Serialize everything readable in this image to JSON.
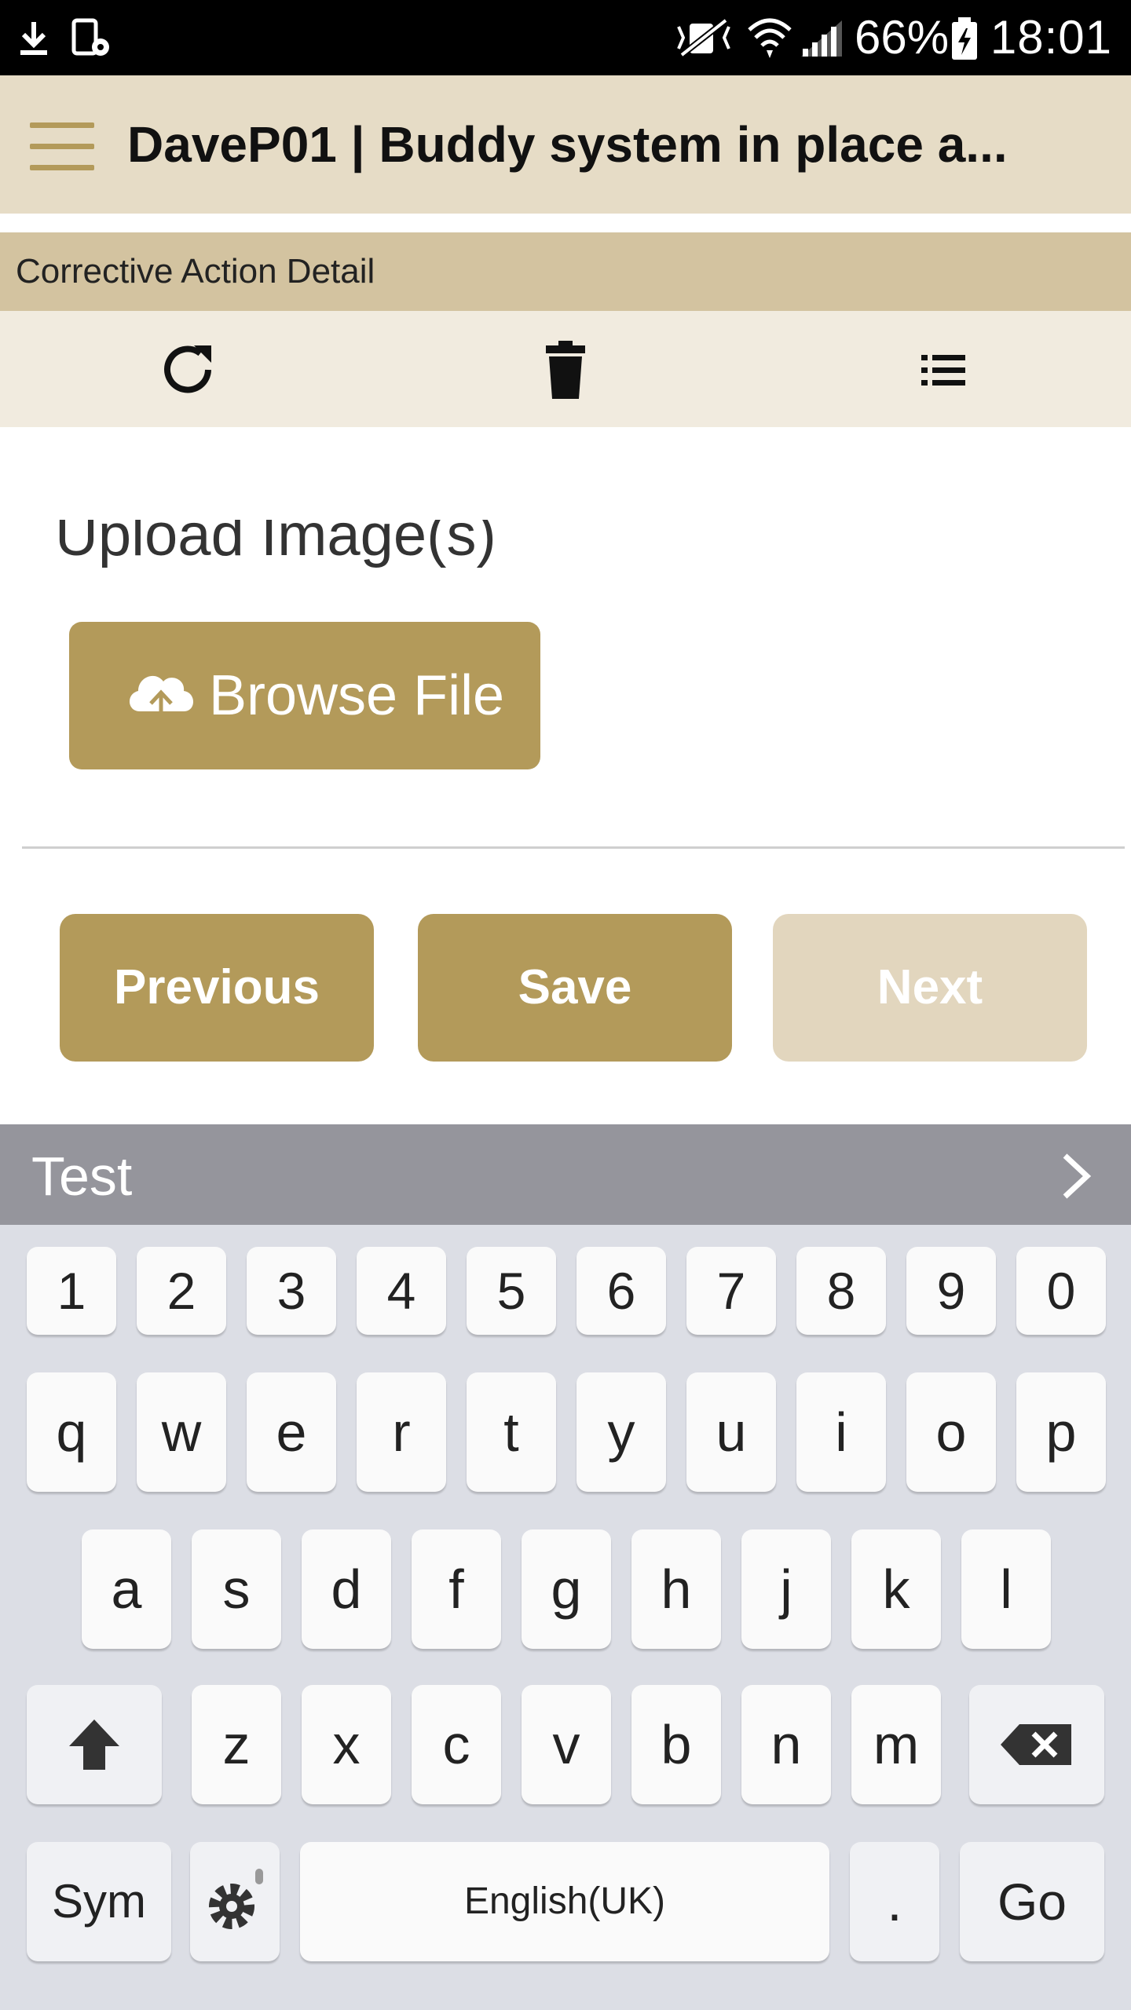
{
  "status_bar": {
    "battery_percent": "66%",
    "time": "18:01",
    "icons": [
      "download-icon",
      "phone-settings-icon",
      "mute-icon",
      "wifi-icon",
      "signal-icon",
      "battery-charging-icon"
    ]
  },
  "app_bar": {
    "title": "DaveP01 | Buddy system in place a...",
    "menu_icon": "hamburger-icon"
  },
  "section": {
    "title": "Corrective Action Detail"
  },
  "toolbar": {
    "icons": [
      "refresh-icon",
      "delete-icon",
      "list-icon"
    ]
  },
  "form": {
    "upload_label": "Upload Image(s)",
    "browse_button": "Browse File"
  },
  "navigation": {
    "previous": "Previous",
    "save": "Save",
    "next": "Next",
    "next_enabled": false
  },
  "colors": {
    "accent": "#b39a5a",
    "accent_disabled": "#e2d6be",
    "appbar_bg": "#e6dcc6",
    "section_bg": "#d3c3a0",
    "toolbar_bg": "#f1ebdf"
  },
  "keyboard": {
    "suggestion": "Test",
    "numbers": [
      "1",
      "2",
      "3",
      "4",
      "5",
      "6",
      "7",
      "8",
      "9",
      "0"
    ],
    "row1": [
      "q",
      "w",
      "e",
      "r",
      "t",
      "y",
      "u",
      "i",
      "o",
      "p"
    ],
    "row2": [
      "a",
      "s",
      "d",
      "f",
      "g",
      "h",
      "j",
      "k",
      "l"
    ],
    "row3": [
      "z",
      "x",
      "c",
      "v",
      "b",
      "n",
      "m"
    ],
    "sym": "Sym",
    "space": "English(UK)",
    "period": ".",
    "go": "Go"
  }
}
